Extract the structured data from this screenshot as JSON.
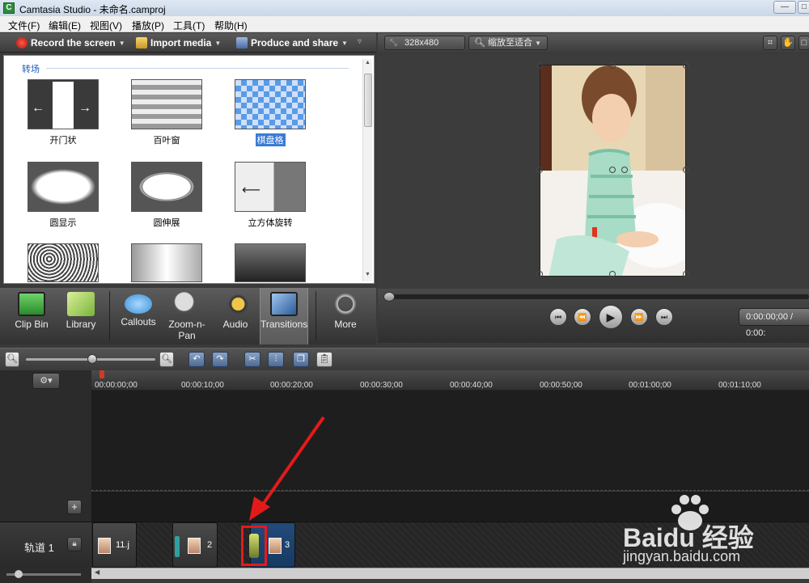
{
  "window": {
    "title": "Camtasia Studio - 未命名.camproj"
  },
  "menu": [
    "文件(F)",
    "编辑(E)",
    "视图(V)",
    "播放(P)",
    "工具(T)",
    "帮助(H)"
  ],
  "toolbar": {
    "record_label": "Record the screen",
    "import_label": "Import media",
    "produce_label": "Produce and share"
  },
  "panel": {
    "section_title": "转场",
    "transitions": [
      {
        "label": "开门状",
        "selected": false
      },
      {
        "label": "百叶窗",
        "selected": false
      },
      {
        "label": "棋盘格",
        "selected": true
      },
      {
        "label": "圆显示",
        "selected": false
      },
      {
        "label": "圆伸展",
        "selected": false
      },
      {
        "label": "立方体旋转",
        "selected": false
      },
      {
        "label": "",
        "selected": false
      },
      {
        "label": "",
        "selected": false
      },
      {
        "label": "",
        "selected": false
      }
    ]
  },
  "tabs": [
    {
      "label": "Clip Bin",
      "icon": "film-icon"
    },
    {
      "label": "Library",
      "icon": "folder-icon"
    },
    {
      "label": "Callouts",
      "icon": "speech-bubble-icon"
    },
    {
      "label": "Zoom-n-",
      "label2": "Pan",
      "icon": "magnifier-icon"
    },
    {
      "label": "Audio",
      "icon": "speaker-icon"
    },
    {
      "label": "Transitions",
      "icon": "transition-icon",
      "active": true
    },
    {
      "label": "More",
      "icon": "dots-icon"
    }
  ],
  "preview": {
    "size_label": "328x480",
    "zoom_label": "缩放至适合",
    "time_display": "0:00:00;00 / 0:00:"
  },
  "timeline": {
    "ticks": [
      "00:00:00;00",
      "00:00:10;00",
      "00:00:20;00",
      "00:00:30;00",
      "00:00:40;00",
      "00:00:50;00",
      "00:01:00;00",
      "00:01:10;00"
    ],
    "track_name": "轨道 1",
    "clips": [
      {
        "label": "11.j"
      },
      {
        "label": "2"
      },
      {
        "label": "3"
      }
    ]
  },
  "watermark": {
    "brand": "Baidu 经验",
    "url": "jingyan.baidu.com"
  }
}
